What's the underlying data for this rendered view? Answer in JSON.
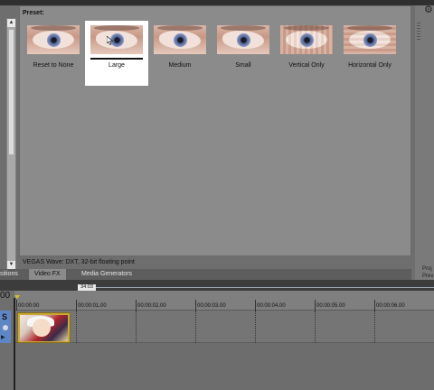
{
  "presets_panel": {
    "header": "Preset:",
    "items": [
      {
        "label": "Reset to None",
        "selected": false,
        "style": "normal"
      },
      {
        "label": "Large",
        "selected": true,
        "style": "distort"
      },
      {
        "label": "Medium",
        "selected": false,
        "style": "distort"
      },
      {
        "label": "Small",
        "selected": false,
        "style": "distort"
      },
      {
        "label": "Vertical Only",
        "selected": false,
        "style": "wave"
      },
      {
        "label": "Horizontal Only",
        "selected": false,
        "style": "hwave"
      }
    ],
    "status": "VEGAS Wave: DXT, 32-bit floating point"
  },
  "tabs": {
    "partial_left": "sitions",
    "items": [
      "Video FX",
      "Media Generators"
    ],
    "active": "Video FX"
  },
  "right_panel": {
    "label_1": "Proj",
    "label_2": "Prev"
  },
  "timeline": {
    "cursor_time": "34:03",
    "left_timecode": "00",
    "ticks": [
      "00:00:00",
      "00:00:01.00",
      "00:00:02.00",
      "00:00:03.00",
      "00:00:04.00",
      "00:00:05.00",
      "00:00:06.00"
    ],
    "track_solo": "S"
  },
  "icons": {
    "scroll_up": "scroll-up-arrow-icon",
    "scroll_down": "scroll-down-arrow-icon",
    "gear": "gear-icon",
    "pointer": "mouse-cursor-icon"
  },
  "colors": {
    "panel_bg": "#8b8b8b",
    "selected_bg": "#ffffff",
    "track_header": "#5f86c4",
    "clip_border": "#c9a93a"
  }
}
